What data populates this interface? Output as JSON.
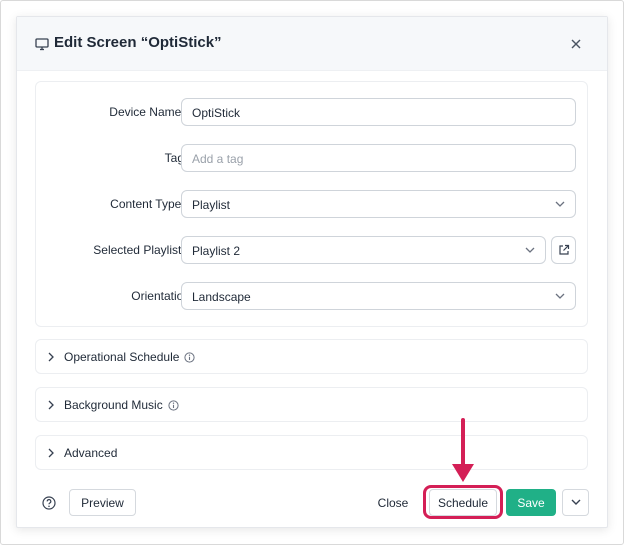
{
  "modal": {
    "title": "Edit Screen  “OptiStick”",
    "title_icon": "monitor-icon",
    "close_icon": "close-icon"
  },
  "form": {
    "device_name": {
      "label": "Device Name",
      "required": "*",
      "value": "OptiStick"
    },
    "tags": {
      "label": "Tags",
      "placeholder": "Add a tag"
    },
    "content_type": {
      "label": "Content Type",
      "required": "*",
      "value": "Playlist"
    },
    "selected_playlist": {
      "label": "Selected Playlist",
      "required": "*",
      "value": "Playlist 2",
      "open_icon": "external-link-icon"
    },
    "orientation": {
      "label": "Orientation",
      "value": "Landscape"
    }
  },
  "sections": [
    {
      "label": "Operational Schedule",
      "has_info": true
    },
    {
      "label": "Background Music",
      "has_info": true
    },
    {
      "label": "Advanced",
      "has_info": false
    }
  ],
  "footer": {
    "help_icon": "help-circle-icon",
    "preview_label": "Preview",
    "close_label": "Close",
    "schedule_label": "Schedule",
    "save_label": "Save",
    "more_icon": "chevron-down-icon"
  },
  "colors": {
    "accent": "#20b087",
    "required": "#e0245e",
    "annotation": "#d41f56"
  }
}
